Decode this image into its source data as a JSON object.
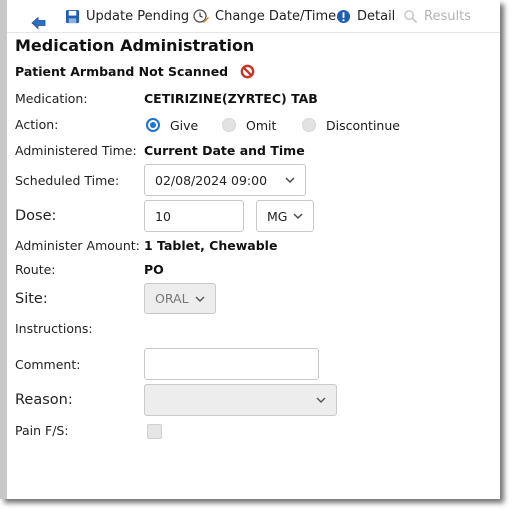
{
  "toolbar": {
    "back_icon": "back-arrow-icon",
    "update_pending": "Update Pending",
    "change_date_time": "Change Date/Time",
    "detail": "Detail",
    "results": "Results"
  },
  "form": {
    "title": "Medication Administration",
    "armband_warning": "Patient Armband Not Scanned",
    "medication_label": "Medication:",
    "medication_value": "CETIRIZINE(ZYRTEC) TAB",
    "action_label": "Action:",
    "action_options": [
      "Give",
      "Omit",
      "Discontinue"
    ],
    "action_selected": "Give",
    "administered_time_label": "Administered Time:",
    "administered_time_value": "Current Date and Time",
    "scheduled_time_label": "Scheduled Time:",
    "scheduled_time_value": "02/08/2024 09:00",
    "dose_label": "Dose:",
    "dose_value": "10",
    "dose_unit": "MG",
    "administer_amount_label": "Administer Amount:",
    "administer_amount_value": "1 Tablet, Chewable",
    "route_label": "Route:",
    "route_value": "PO",
    "site_label": "Site:",
    "site_value": "ORAL",
    "instructions_label": "Instructions:",
    "comment_label": "Comment:",
    "comment_value": "",
    "reason_label": "Reason:",
    "reason_value": "",
    "pain_label": "Pain F/S:",
    "pain_checked": false
  },
  "colors": {
    "accent": "#1a73d9",
    "toolbar_icon_blue": "#1f5fae",
    "warning_red": "#c0392b",
    "disabled_text": "#b4b4b4"
  }
}
